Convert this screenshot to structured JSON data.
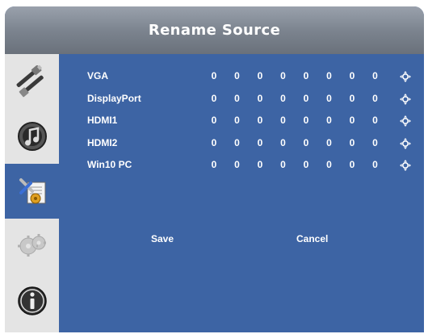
{
  "title": "Rename Source",
  "sidebar": {
    "items": [
      {
        "icon": "cables-icon"
      },
      {
        "icon": "audio-icon"
      },
      {
        "icon": "settings-tools-icon"
      },
      {
        "icon": "gear-icon"
      },
      {
        "icon": "info-icon"
      }
    ],
    "active_index": 2
  },
  "sources": [
    {
      "name": "VGA",
      "chars": [
        "0",
        "0",
        "0",
        "0",
        "0",
        "0",
        "0",
        "0"
      ]
    },
    {
      "name": "DisplayPort",
      "chars": [
        "0",
        "0",
        "0",
        "0",
        "0",
        "0",
        "0",
        "0"
      ]
    },
    {
      "name": "HDMI1",
      "chars": [
        "0",
        "0",
        "0",
        "0",
        "0",
        "0",
        "0",
        "0"
      ]
    },
    {
      "name": "HDMI2",
      "chars": [
        "0",
        "0",
        "0",
        "0",
        "0",
        "0",
        "0",
        "0"
      ]
    },
    {
      "name": "Win10 PC",
      "chars": [
        "0",
        "0",
        "0",
        "0",
        "0",
        "0",
        "0",
        "0"
      ]
    }
  ],
  "buttons": {
    "save": "Save",
    "cancel": "Cancel"
  },
  "colors": {
    "panel": "#3d64a4",
    "title_bar": "#7c848f",
    "sidebar": "#e4e4e4",
    "text": "#ffffff"
  }
}
